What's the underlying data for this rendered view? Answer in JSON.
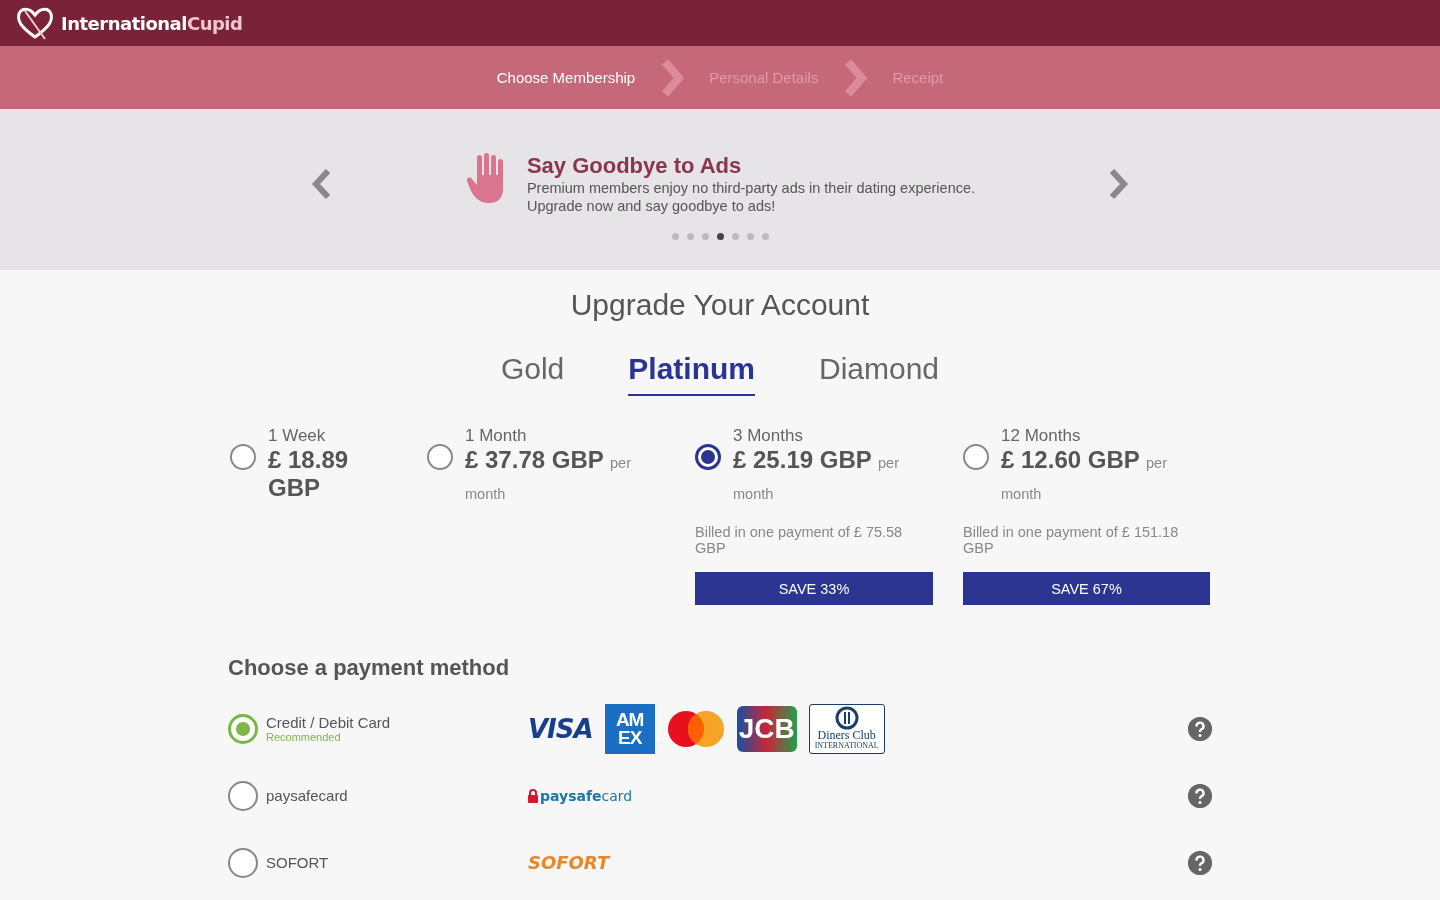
{
  "brand": {
    "name": "International",
    "accent": "Cupid"
  },
  "steps": [
    {
      "label": "Choose Membership",
      "selected": true
    },
    {
      "label": "Personal Details",
      "selected": false
    },
    {
      "label": "Receipt",
      "selected": false
    }
  ],
  "carousel": {
    "title": "Say Goodbye to Ads",
    "text": "Premium members enjoy no third-party ads in their dating experience.\nUpgrade now and say goodbye to ads!",
    "dots": [
      {
        "selected": false
      },
      {
        "selected": false
      },
      {
        "selected": false
      },
      {
        "selected": true
      },
      {
        "selected": false
      },
      {
        "selected": false
      },
      {
        "selected": false
      }
    ]
  },
  "heading": "Upgrade Your Account",
  "tabs": [
    {
      "label": "Gold",
      "selected": false
    },
    {
      "label": "Platinum",
      "selected": true
    },
    {
      "label": "Diamond",
      "selected": false
    }
  ],
  "plans": [
    {
      "period": "1 Week",
      "price": "£ 18.89 GBP",
      "selected": false
    },
    {
      "period": "1 Month",
      "price": "£ 37.78 GBP",
      "unit": "per month",
      "selected": false
    },
    {
      "period": "3 Months",
      "price": "£ 25.19 GBP",
      "unit": "per month",
      "billed": "Billed in one payment of £ 75.58 GBP",
      "save": "SAVE 33%",
      "selected": true
    },
    {
      "period": "12 Months",
      "price": "£ 12.60 GBP",
      "unit": "per month",
      "billed": "Billed in one payment of £ 151.18 GBP",
      "save": "SAVE 67%",
      "selected": false
    }
  ],
  "payment": {
    "title": "Choose a payment method",
    "methods": [
      {
        "label": "Credit / Debit Card",
        "note": "Recommended",
        "selected": true,
        "logos": [
          {
            "kind": "visa",
            "text": "VISA"
          },
          {
            "kind": "amex",
            "text": "AM EX"
          },
          {
            "kind": "mastercard"
          },
          {
            "kind": "jcb",
            "text": "JCB"
          },
          {
            "kind": "diners",
            "text": "Diners Club",
            "subtext": "INTERNATIONAL"
          }
        ]
      },
      {
        "label": "paysafecard",
        "selected": false,
        "logos": [
          {
            "kind": "paysafecard",
            "text": "paysafe",
            "accent": "card"
          }
        ]
      },
      {
        "label": "SOFORT",
        "selected": false,
        "logos": [
          {
            "kind": "sofort",
            "text": "SOFORT"
          }
        ]
      }
    ]
  }
}
